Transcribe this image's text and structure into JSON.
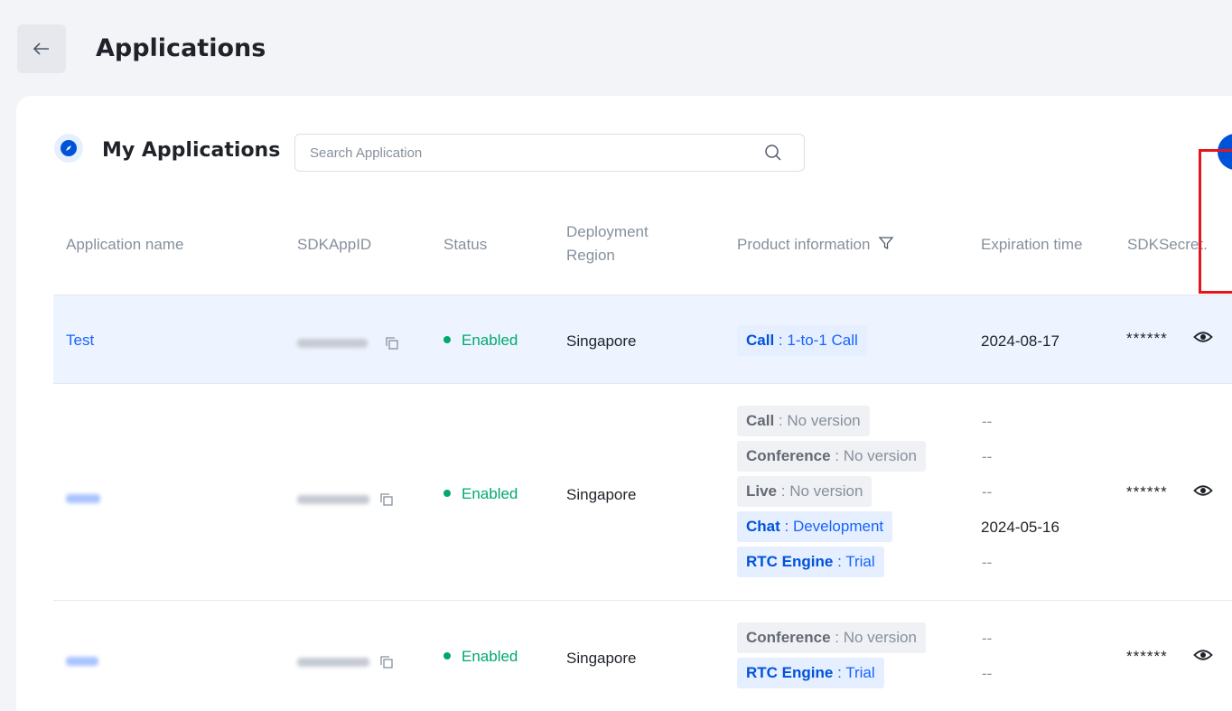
{
  "header": {
    "back_icon": "arrow-left-icon",
    "title": "Applications"
  },
  "section": {
    "icon": "compass-icon",
    "title": "My Applications",
    "search_placeholder": "Search Application",
    "search_icon": "search-icon"
  },
  "table": {
    "columns": {
      "name": "Application name",
      "sdkappid": "SDKAppID",
      "status": "Status",
      "region_line1": "Deployment",
      "region_line2": "Region",
      "product": "Product information",
      "expiration": "Expiration time",
      "secret": "SDKSecret."
    },
    "rows": [
      {
        "name": "Test",
        "status": "Enabled",
        "region": "Singapore",
        "products": [
          {
            "product": "Call",
            "sep": " : ",
            "version": "1-to-1 Call",
            "expiration": "2024-08-17"
          }
        ],
        "secret": "******"
      },
      {
        "name": "",
        "status": "Enabled",
        "region": "Singapore",
        "products": [
          {
            "product": "Call",
            "sep": " : ",
            "version": "No version",
            "expiration": "--"
          },
          {
            "product": "Conference",
            "sep": " : ",
            "version": "No version",
            "expiration": "--"
          },
          {
            "product": "Live",
            "sep": " : ",
            "version": "No version",
            "expiration": "--"
          },
          {
            "product": "Chat",
            "sep": " : ",
            "version": "Development",
            "expiration": "2024-05-16"
          },
          {
            "product": "RTC Engine",
            "sep": " : ",
            "version": "Trial",
            "expiration": "--"
          }
        ],
        "secret": "******"
      },
      {
        "name": "",
        "status": "Enabled",
        "region": "Singapore",
        "products": [
          {
            "product": "Conference",
            "sep": " : ",
            "version": "No version",
            "expiration": "--"
          },
          {
            "product": "RTC Engine",
            "sep": " : ",
            "version": "Trial",
            "expiration": "--"
          }
        ],
        "secret": "******"
      }
    ]
  },
  "colors": {
    "primary": "#0052d9",
    "link": "#1664ff",
    "success": "#00a870",
    "highlight": "#e5151b",
    "selected_row": "#eef4ff"
  }
}
